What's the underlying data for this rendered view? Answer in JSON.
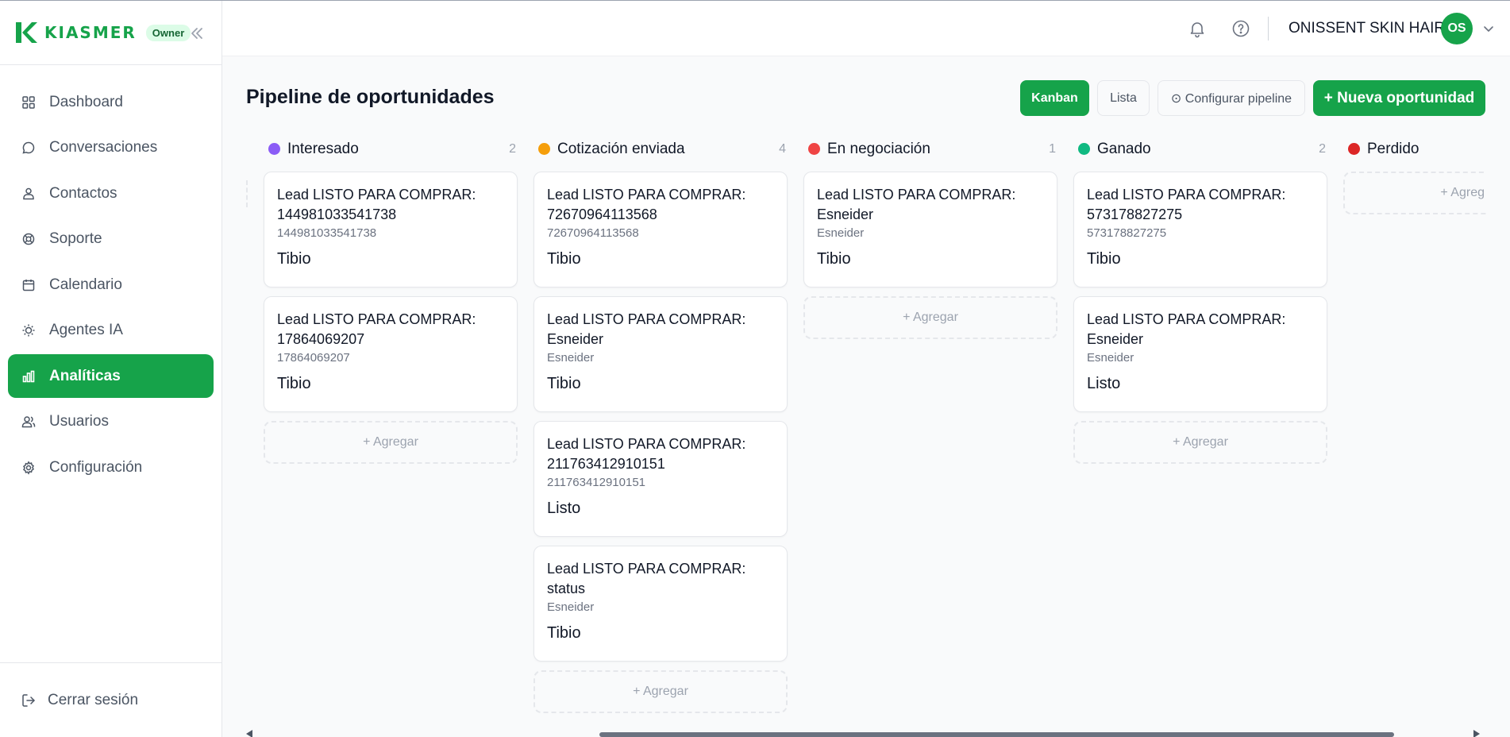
{
  "brand": {
    "name": "KIASMER",
    "role_badge": "Owner",
    "accent": "#16a34a"
  },
  "sidebar": {
    "items": [
      {
        "label": "Dashboard",
        "icon": "grid-icon"
      },
      {
        "label": "Conversaciones",
        "icon": "chat-bubble-icon"
      },
      {
        "label": "Contactos",
        "icon": "contacts-icon"
      },
      {
        "label": "Soporte",
        "icon": "lifebuoy-icon"
      },
      {
        "label": "Calendario",
        "icon": "calendar-icon"
      },
      {
        "label": "Agentes IA",
        "icon": "lightbulb-icon"
      },
      {
        "label": "Analíticas",
        "icon": "bar-chart-icon",
        "active": true
      },
      {
        "label": "Usuarios",
        "icon": "users-icon"
      },
      {
        "label": "Configuración",
        "icon": "gear-icon"
      }
    ],
    "logout_label": "Cerrar sesión"
  },
  "header": {
    "company": "ONISSENT SKIN HAIR",
    "avatar_initials": "OS"
  },
  "page": {
    "title": "Pipeline de oportunidades",
    "view_kanban": "Kanban",
    "view_lista": "Lista",
    "configure_pipeline": "⊙ Configurar pipeline",
    "new_opportunity": "+ Nueva oportunidad"
  },
  "board": {
    "add_label": "+ Agregar",
    "add_label_clipped": "+ Agreg",
    "columns": [
      {
        "title": "Interesado",
        "count": "2",
        "color": "#8b5cf6",
        "cards": [
          {
            "title": "Lead LISTO PARA COMPRAR: 144981033541738",
            "subtitle": "144981033541738",
            "tag": "Tibio"
          },
          {
            "title": "Lead LISTO PARA COMPRAR: 17864069207",
            "subtitle": "17864069207",
            "tag": "Tibio"
          }
        ]
      },
      {
        "title": "Cotización enviada",
        "count": "4",
        "color": "#f59e0b",
        "cards": [
          {
            "title": "Lead LISTO PARA COMPRAR: 72670964113568",
            "subtitle": "72670964113568",
            "tag": "Tibio"
          },
          {
            "title": "Lead LISTO PARA COMPRAR: Esneider",
            "subtitle": "Esneider",
            "tag": "Tibio"
          },
          {
            "title": "Lead LISTO PARA COMPRAR: 211763412910151",
            "subtitle": "211763412910151",
            "tag": "Listo"
          },
          {
            "title": "Lead LISTO PARA COMPRAR: status",
            "subtitle": "Esneider",
            "tag": "Tibio"
          }
        ]
      },
      {
        "title": "En negociación",
        "count": "1",
        "color": "#ef4444",
        "cards": [
          {
            "title": "Lead LISTO PARA COMPRAR: Esneider",
            "subtitle": "Esneider",
            "tag": "Tibio"
          }
        ]
      },
      {
        "title": "Ganado",
        "count": "2",
        "color": "#10b981",
        "cards": [
          {
            "title": "Lead LISTO PARA COMPRAR: 573178827275",
            "subtitle": "573178827275",
            "tag": "Tibio"
          },
          {
            "title": "Lead LISTO PARA COMPRAR: Esneider",
            "subtitle": "Esneider",
            "tag": "Listo"
          }
        ]
      },
      {
        "title": "Perdido",
        "count": "",
        "color": "#dc2626",
        "cards": []
      }
    ]
  }
}
